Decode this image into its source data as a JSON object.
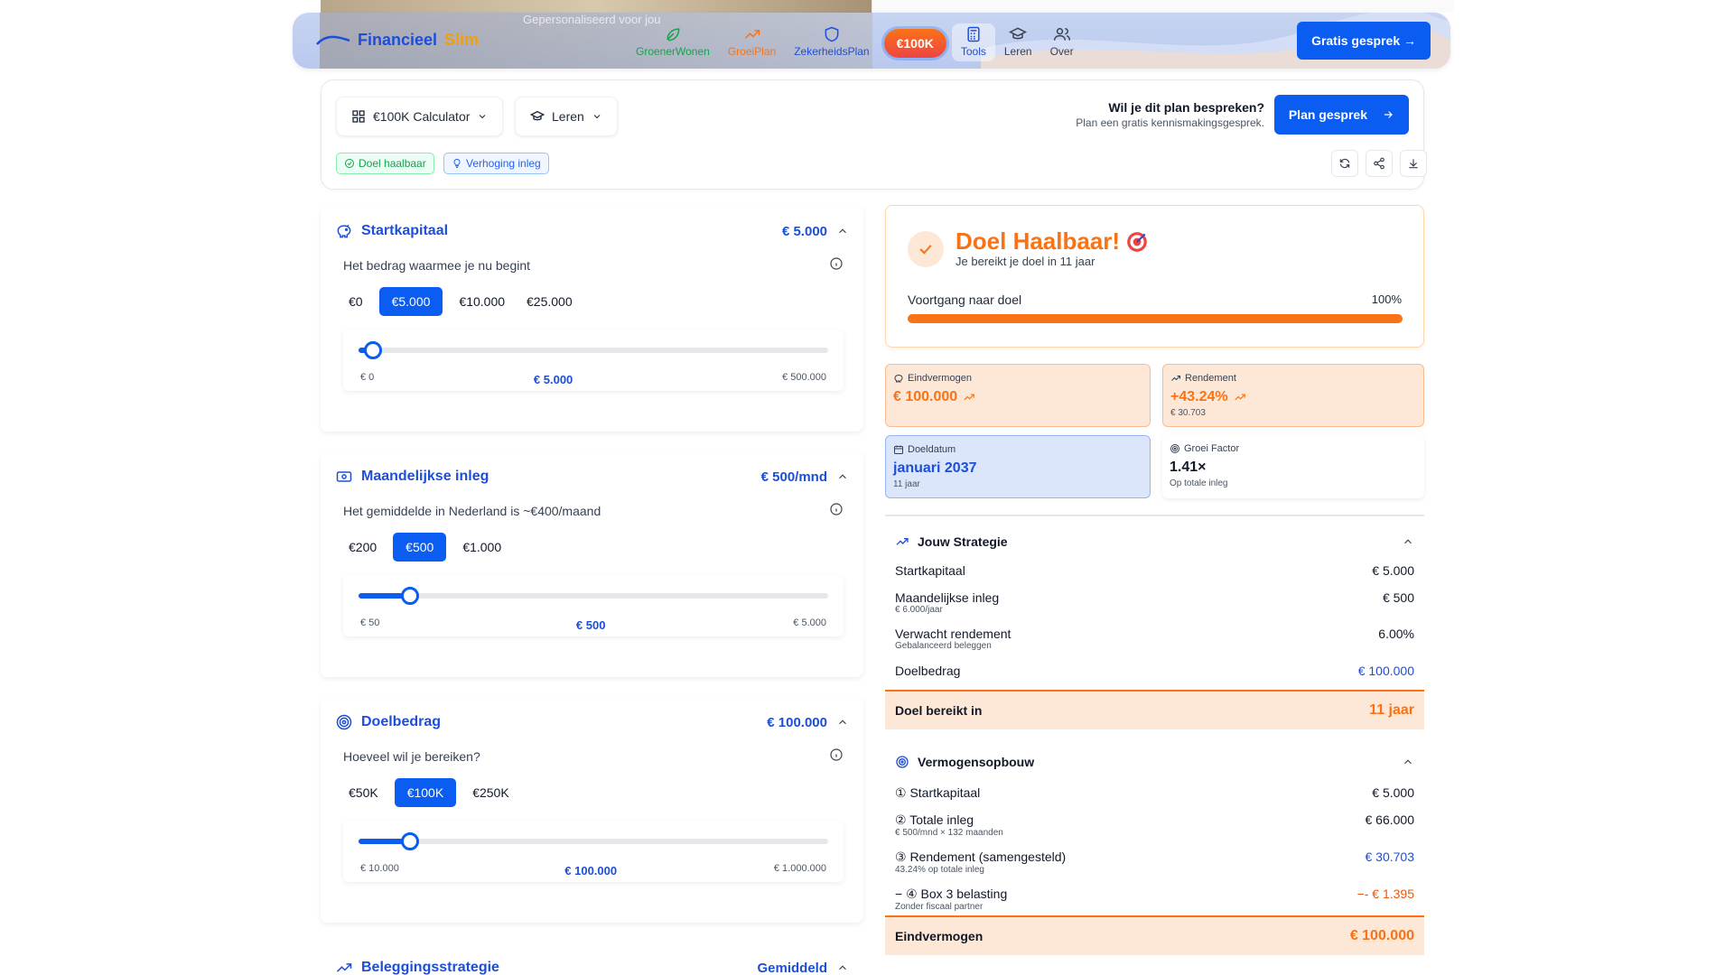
{
  "hero": {
    "overlay_text": "Gepersonaliseerd voor jou"
  },
  "nav": {
    "logo_part1": "Financieel",
    "logo_part2": "Slim",
    "items": [
      {
        "label": "GroenerWonen",
        "icon": "leaf-icon"
      },
      {
        "label": "GroeiPlan",
        "icon": "trend-up-icon"
      },
      {
        "label": "ZekerheidsPlan",
        "icon": "shield-icon"
      },
      {
        "label": "€100K",
        "icon": ""
      },
      {
        "label": "Tools",
        "icon": "calculator-icon"
      },
      {
        "label": "Leren",
        "icon": "graduation-cap-icon"
      },
      {
        "label": "Over",
        "icon": "users-icon"
      }
    ],
    "cta": "Gratis gesprek →"
  },
  "toolbar": {
    "calculator_label": "€100K Calculator",
    "learn_label": "Leren",
    "question": "Wil je dit plan bespreken?",
    "subtext": "Plan een gratis kennismakingsgesprek.",
    "plan_button": "Plan gesprek",
    "tag_goal": "Doel haalbaar",
    "tag_increase": "Verhoging inleg"
  },
  "inputs": {
    "start": {
      "title": "Startkapitaal",
      "value": "€ 5.000",
      "desc": "Het bedrag waarmee je nu begint",
      "chips": [
        "€0",
        "€5.000",
        "€10.000",
        "€25.000"
      ],
      "active": 1,
      "min": "€ 0",
      "max": "€ 500.000",
      "current": "€ 5.000",
      "fraction": 0.03
    },
    "monthly": {
      "title": "Maandelijkse inleg",
      "value": "€ 500/mnd",
      "desc": "Het gemiddelde in Nederland is ~€400/maand",
      "chips": [
        "€200",
        "€500",
        "€1.000"
      ],
      "active": 1,
      "min": "€ 50",
      "max": "€ 5.000",
      "current": "€ 500",
      "fraction": 0.11
    },
    "target": {
      "title": "Doelbedrag",
      "value": "€ 100.000",
      "desc": "Hoeveel wil je bereiken?",
      "chips": [
        "€50K",
        "€100K",
        "€250K"
      ],
      "active": 1,
      "min": "€ 10.000",
      "max": "€ 1.000.000",
      "current": "€ 100.000",
      "fraction": 0.11
    },
    "strategy": {
      "title": "Beleggingsstrategie",
      "value": "Gemiddeld"
    }
  },
  "goal": {
    "title": "Doel Haalbaar!",
    "subtitle": "Je bereikt je doel in 11 jaar",
    "progress_label": "Voortgang naar doel",
    "progress_text": "100%",
    "progress": 1.0
  },
  "stats": {
    "end": {
      "label": "Eindvermogen",
      "value": "€ 100.000"
    },
    "return": {
      "label": "Rendement",
      "value": "+43.24%",
      "sub": "€ 30.703"
    },
    "date": {
      "label": "Doeldatum",
      "value": "januari 2037",
      "sub": "11 jaar"
    },
    "factor": {
      "label": "Groei Factor",
      "value": "1.41×",
      "sub": "Op totale inleg"
    }
  },
  "strategy_card": {
    "title": "Jouw Strategie",
    "rows": [
      {
        "k": "Startkapitaal",
        "s": "",
        "v": "€ 5.000"
      },
      {
        "k": "Maandelijkse inleg",
        "s": "€ 6.000/jaar",
        "v": "€ 500"
      },
      {
        "k": "Verwacht rendement",
        "s": "Gebalanceerd beleggen",
        "v": "6.00%"
      },
      {
        "k": "Doelbedrag",
        "s": "",
        "v": "€ 100.000"
      }
    ],
    "total_label": "Doel bereikt in",
    "total_value": "11 jaar"
  },
  "wealth_card": {
    "title": "Vermogensopbouw",
    "rows": [
      {
        "k": "① Startkapitaal",
        "s": "",
        "v": "€ 5.000"
      },
      {
        "k": "② Totale inleg",
        "s": "€ 500/mnd × 132 maanden",
        "v": "€ 66.000"
      },
      {
        "k": "③ Rendement (samengesteld)",
        "s": "43.24% op totale inleg",
        "v": "€ 30.703"
      },
      {
        "k": "− ④ Box 3 belasting",
        "s": "Zonder fiscaal partner",
        "v": "−- € 1.395"
      }
    ],
    "total_label": "Eindvermogen",
    "total_value": "€ 100.000"
  },
  "colors": {
    "primary": "#0b5cf0",
    "accent": "#f97316",
    "success": "#16a34a"
  }
}
